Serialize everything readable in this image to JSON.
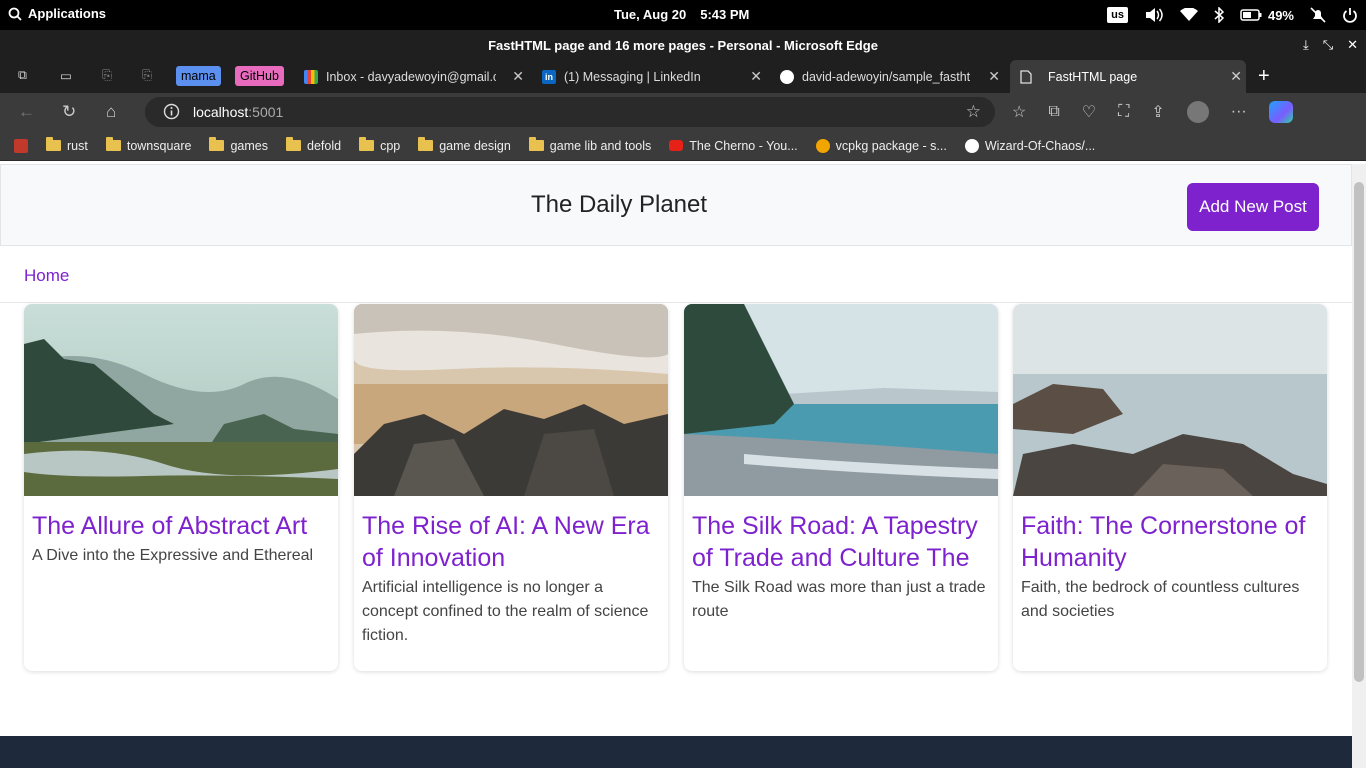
{
  "os_bar": {
    "applications_label": "Applications",
    "date": "Tue, Aug 20",
    "time": "5:43 PM",
    "keyboard_layout": "us",
    "battery_percent": "49%"
  },
  "browser": {
    "window_title": "FastHTML page and 16 more pages - Personal - Microsoft Edge",
    "tab_groups": [
      "mama",
      "GitHub"
    ],
    "tabs": [
      {
        "label": "Inbox - davyadewoyin@gmail.c",
        "icon": "gmail-icon"
      },
      {
        "label": "(1) Messaging | LinkedIn",
        "icon": "linkedin-icon"
      },
      {
        "label": "david-adewoyin/sample_fastht",
        "icon": "github-icon"
      },
      {
        "label": "FastHTML page",
        "icon": "page-icon",
        "active": true
      }
    ],
    "url_host": "localhost",
    "url_port": ":5001",
    "bookmarks": [
      {
        "label": "",
        "icon": "app-icon"
      },
      {
        "label": "rust",
        "icon": "folder-icon"
      },
      {
        "label": "townsquare",
        "icon": "folder-icon"
      },
      {
        "label": "games",
        "icon": "folder-icon"
      },
      {
        "label": "defold",
        "icon": "folder-icon"
      },
      {
        "label": "cpp",
        "icon": "folder-icon"
      },
      {
        "label": "game design",
        "icon": "folder-icon"
      },
      {
        "label": "game lib and tools",
        "icon": "folder-icon"
      },
      {
        "label": "The Cherno - You...",
        "icon": "youtube-icon"
      },
      {
        "label": "vcpkg package - s...",
        "icon": "vcpkg-icon"
      },
      {
        "label": "Wizard-Of-Chaos/...",
        "icon": "github-icon"
      }
    ]
  },
  "page": {
    "site_title": "The Daily Planet",
    "add_post_label": "Add New Post",
    "home_label": "Home",
    "accent_color": "#7e22ce",
    "posts": [
      {
        "title": "The Allure of Abstract Art",
        "excerpt": "A Dive into the Expressive and Ethereal",
        "image": "foggy-forest-river"
      },
      {
        "title": "The Rise of AI: A New Era of Innovation",
        "excerpt": "Artificial intelligence is no longer a concept confined to the realm of science fiction.",
        "image": "beach-rocks"
      },
      {
        "title": "The Silk Road: A Tapestry of Trade and Culture The",
        "excerpt": "The Silk Road was more than just a trade route",
        "image": "pebble-shore"
      },
      {
        "title": "Faith: The Cornerstone of Humanity",
        "excerpt": "Faith, the bedrock of countless cultures and societies",
        "image": "rocky-coast"
      }
    ]
  }
}
